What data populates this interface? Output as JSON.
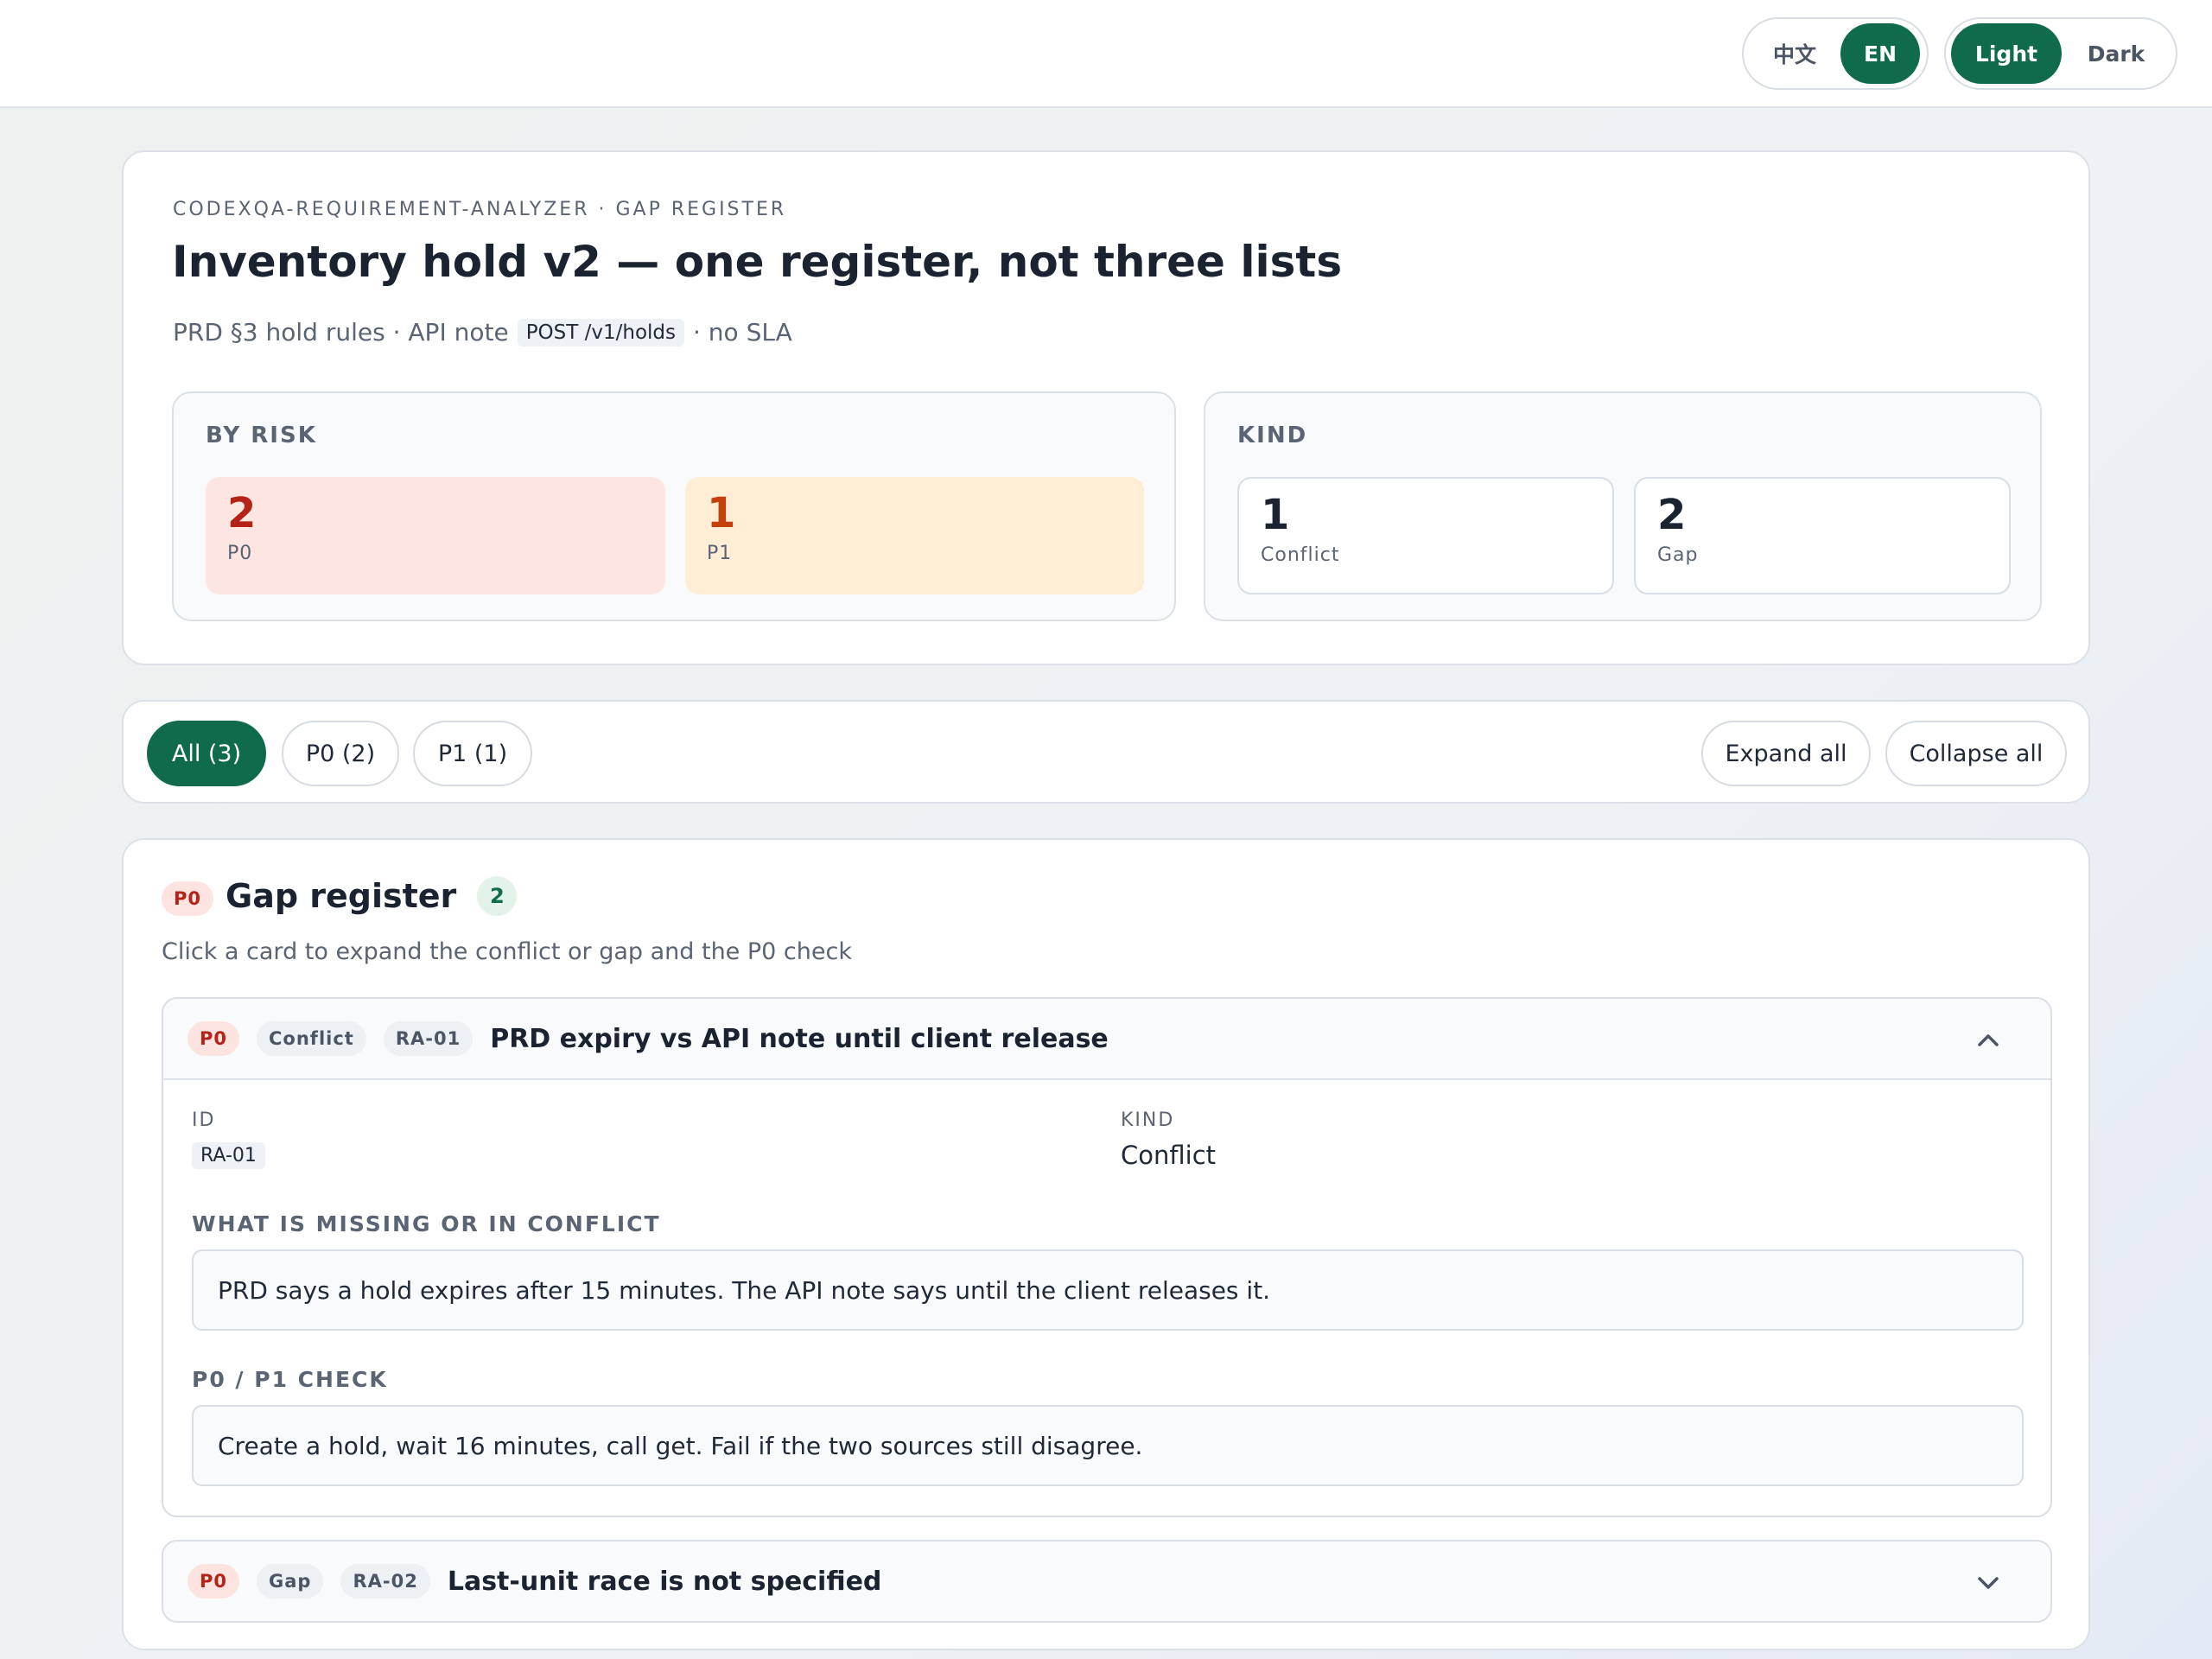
{
  "topbar": {
    "lang_options": [
      "中文",
      "EN"
    ],
    "lang_selected": "EN",
    "theme_options": [
      "Light",
      "Dark"
    ],
    "theme_selected": "Light"
  },
  "hero": {
    "eyebrow": "CODEXQA-REQUIREMENT-ANALYZER · GAP REGISTER",
    "title": "Inventory hold v2 — one register, not three lists",
    "subtitle_pre": "PRD §3 hold rules · API note",
    "subtitle_code": "POST /v1/holds",
    "subtitle_post": "· no SLA",
    "by_risk": {
      "label": "BY RISK",
      "stats": [
        {
          "value": "2",
          "label": "P0",
          "color": "#b42318",
          "bg": "#fde6e2"
        },
        {
          "value": "1",
          "label": "P1",
          "color": "#c2410c",
          "bg": "#ffedd5"
        }
      ]
    },
    "kind": {
      "label": "KIND",
      "stats": [
        {
          "value": "1",
          "label": "Conflict"
        },
        {
          "value": "2",
          "label": "Gap"
        }
      ]
    }
  },
  "filters": {
    "tabs": [
      "All (3)",
      "P0 (2)",
      "P1 (1)"
    ],
    "selected": "All (3)",
    "expand_all": "Expand all",
    "collapse_all": "Collapse all"
  },
  "register": {
    "badge": "P0",
    "title": "Gap register",
    "count": "2",
    "hint": "Click a card to expand the conflict or gap and the P0 check",
    "items": [
      {
        "risk": "P0",
        "kind": "Conflict",
        "id": "RA-01",
        "title": "PRD expiry vs API note until client release",
        "expanded": true,
        "id_label": "ID",
        "kind_label": "KIND",
        "missing_label": "WHAT IS MISSING OR IN CONFLICT",
        "missing_text": "PRD says a hold expires after 15 minutes. The API note says until the client releases it.",
        "check_label": "P0 / P1 CHECK",
        "check_text": "Create a hold, wait 16 minutes, call get. Fail if the two sources still disagree."
      },
      {
        "risk": "P0",
        "kind": "Gap",
        "id": "RA-02",
        "title": "Last-unit race is not specified",
        "expanded": false
      }
    ]
  },
  "icons": {
    "expanded": "chevron-up-icon",
    "collapsed": "chevron-down-icon"
  }
}
